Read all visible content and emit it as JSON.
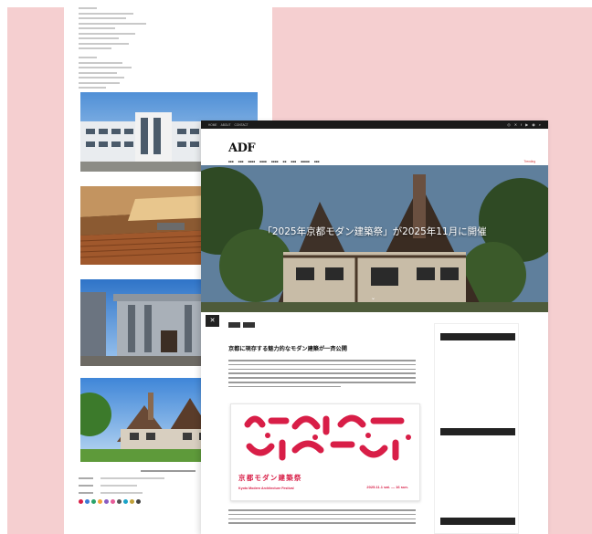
{
  "colors": {
    "panel": "#f5cfd0",
    "accent": "#d81e47",
    "dark": "#1a1a1a"
  },
  "topbar": {
    "links": [
      "HOME",
      "ABOUT",
      "CONTACT"
    ],
    "icon_names": [
      "instagram-icon",
      "twitter-icon",
      "facebook-icon",
      "youtube-icon",
      "rss-icon",
      "search-icon"
    ]
  },
  "header": {
    "logo": "ADF",
    "trending": "Trending"
  },
  "hero": {
    "title": "「2025年京都モダン建築祭」が2025年11月に開催"
  },
  "poster": {
    "title": "京都モダン建築祭",
    "subtitle": "Kyoto Modern Architecture Festival",
    "date": "2025.11.1 sat. — 16 sun."
  },
  "article": {
    "title": "京都に現存する魅力的なモダン建築が一斉公開"
  },
  "left_page": {
    "swatches": [
      "#d81e47",
      "#3a7bd5",
      "#2aa36b",
      "#f2a33a",
      "#8a5cc2",
      "#e85d9a",
      "#555555",
      "#1aa3c7",
      "#c2a23a",
      "#444444"
    ]
  }
}
